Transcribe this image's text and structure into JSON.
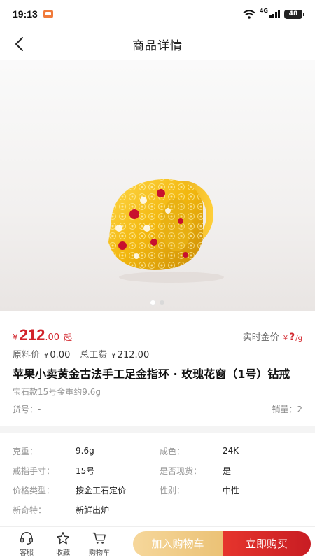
{
  "status_bar": {
    "time": "19:13",
    "network": "4G",
    "battery": "48"
  },
  "nav": {
    "title": "商品详情"
  },
  "gallery": {
    "image_count": 2,
    "active_index": 0
  },
  "price": {
    "currency": "¥",
    "integer": "212",
    "decimal": ".00",
    "suffix": "起",
    "gold_label": "实时金价",
    "gold_currency": "¥",
    "gold_value": "?",
    "gold_unit": "/g"
  },
  "fees": {
    "material_label": "原料价",
    "material_currency": "¥",
    "material_value": "0.00",
    "labor_label": "总工费",
    "labor_currency": "¥",
    "labor_value": "212.00"
  },
  "product": {
    "title": "苹果小卖黄金古法手工足金指环 · 玫瑰花窗（1号）钻戒",
    "subtitle": "宝石款15号金重约9.6g",
    "sku_label": "货号：-",
    "sales_label": "销量：2"
  },
  "specs": [
    [
      {
        "label": "克重：",
        "value": "9.6g"
      },
      {
        "label": "成色：",
        "value": "24K"
      }
    ],
    [
      {
        "label": "戒指手寸：",
        "value": "15号"
      },
      {
        "label": "是否现货：",
        "value": "是"
      }
    ],
    [
      {
        "label": "价格类型：",
        "value": "按金工石定价"
      },
      {
        "label": "性别：",
        "value": "中性"
      }
    ],
    [
      {
        "label": "新奇特：",
        "value": "新鲜出炉"
      }
    ]
  ],
  "bottom_bar": {
    "service_label": "客服",
    "favorite_label": "收藏",
    "cart_label": "购物车",
    "add_to_cart": "加入购物车",
    "buy_now": "立即购买"
  },
  "icons": {
    "back": "chevron-left-icon",
    "service": "headset-icon",
    "favorite": "star-icon",
    "cart": "cart-icon"
  },
  "colors": {
    "accent_red": "#d2232a",
    "gold_button": "#ebc276",
    "buy_button": "#c81d23"
  }
}
